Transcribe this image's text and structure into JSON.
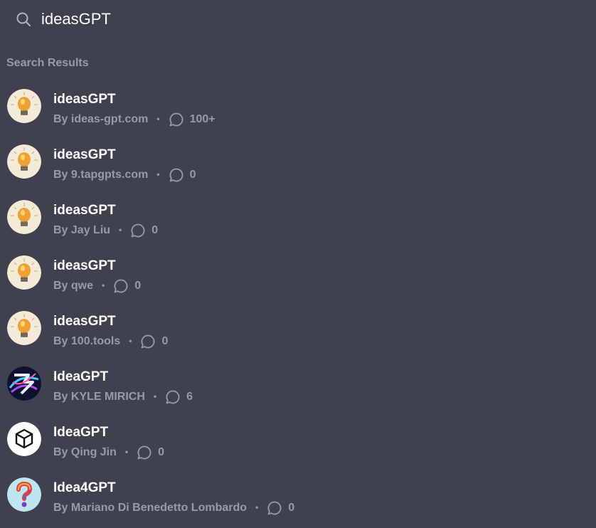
{
  "search": {
    "value": "ideasGPT",
    "icon": "search-icon"
  },
  "section_heading": "Search Results",
  "separator": "•",
  "results": [
    {
      "title": "ideasGPT",
      "author": "By ideas-gpt.com",
      "chats": "100+",
      "avatar": "lightbulb"
    },
    {
      "title": "ideasGPT",
      "author": "By 9.tapgpts.com",
      "chats": "0",
      "avatar": "lightbulb"
    },
    {
      "title": "ideasGPT",
      "author": "By Jay Liu",
      "chats": "0",
      "avatar": "lightbulb"
    },
    {
      "title": "ideasGPT",
      "author": "By qwe",
      "chats": "0",
      "avatar": "lightbulb"
    },
    {
      "title": "ideasGPT",
      "author": "By 100.tools",
      "chats": "0",
      "avatar": "lightbulb"
    },
    {
      "title": "IdeaGPT",
      "author": "By KYLE MIRICH",
      "chats": "6",
      "avatar": "abstract-swirl"
    },
    {
      "title": "IdeaGPT",
      "author": "By Qing Jin",
      "chats": "0",
      "avatar": "cube"
    },
    {
      "title": "Idea4GPT",
      "author": "By Mariano Di Benedetto Lombardo",
      "chats": "0",
      "avatar": "question-mark"
    }
  ],
  "colors": {
    "background": "#40414f",
    "muted": "#9a9aa6",
    "title": "#ffffff"
  }
}
